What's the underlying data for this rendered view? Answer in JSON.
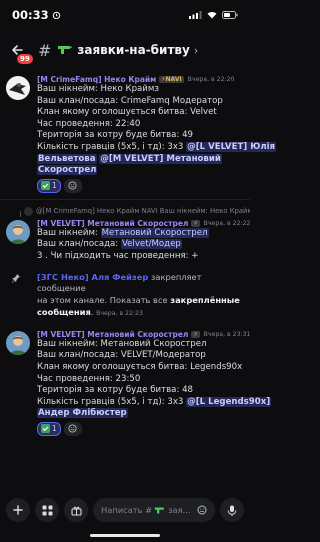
{
  "status": {
    "time": "00:33"
  },
  "header": {
    "back_badge": "99",
    "channel_name": "заявки-на-битву"
  },
  "messages": [
    {
      "author": "[M CrimeFamq] Неко Крайм",
      "tag": "NAVI",
      "time": "Вчера, в 22:20",
      "lines": [
        "Ваш нікнейм: Неко Краймз",
        "Ваш клан/посада: CrimeFamq  Модератор",
        "Клан якому оголошується битва: Velvet",
        "Час проведення: 22:40",
        "Територія за котру буде битва: 49"
      ],
      "players_prefix": "Кількість гравців (5х5, і тд): 3х3 ",
      "mention_1": "@[L VELVET] Юлія",
      "mention_1b": "Вельветова",
      "mention_2": "@[M VELVET] Метановий",
      "mention_2b": "Скорострел",
      "reaction_count": "1"
    },
    {
      "reply": "@[M CrimeFamq] Неко Крайм  NAVI  Ваш нікнейм: Неко Краймз Ваш клан/посада: CrimeFamq Модератор Клан…",
      "reply_tag": "NAVI",
      "author": "[M VELVET] Метановий Скорострел",
      "time": "Вчера, в 22:22",
      "line_1_prefix": "Ваш нікнейм: ",
      "line_1_hl": "Метановий Скорострел",
      "line_2_prefix": "Ваш клан/посада: ",
      "line_2_hl": "Velvet/Модер",
      "line_3": "3 . Чи підходить час проведення: +"
    },
    {
      "system_who": "[ЗГС Неко] Аля Фейзер",
      "system_text_1": " закрепляет сообщение",
      "system_text_2": "на этом канале. Показать все ",
      "system_link": "закреплённые",
      "system_link_2": "сообщения",
      "system_time": "Вчера, в 22:23"
    },
    {
      "author": "[M VELVET] Метановий Скорострел",
      "time": "Вчера, в 23:31",
      "lines": [
        "Ваш нікнейм: Метановий Скорострел",
        "Ваш клан/посада: VELVET/Модератор",
        "Клан якому оголошується битва: Legends90x",
        "Час проведення: 23:50",
        "Територія за котру буде битва: 48"
      ],
      "players_prefix": "Кількість гравців (5х5, і тд): 3х3 ",
      "mention_1": "@[L Legends90x]",
      "mention_1b": "Андер Флібюстер",
      "reaction_count": "1"
    }
  ],
  "composer": {
    "placeholder_prefix": "Написать #",
    "placeholder_suffix": " зая..."
  }
}
